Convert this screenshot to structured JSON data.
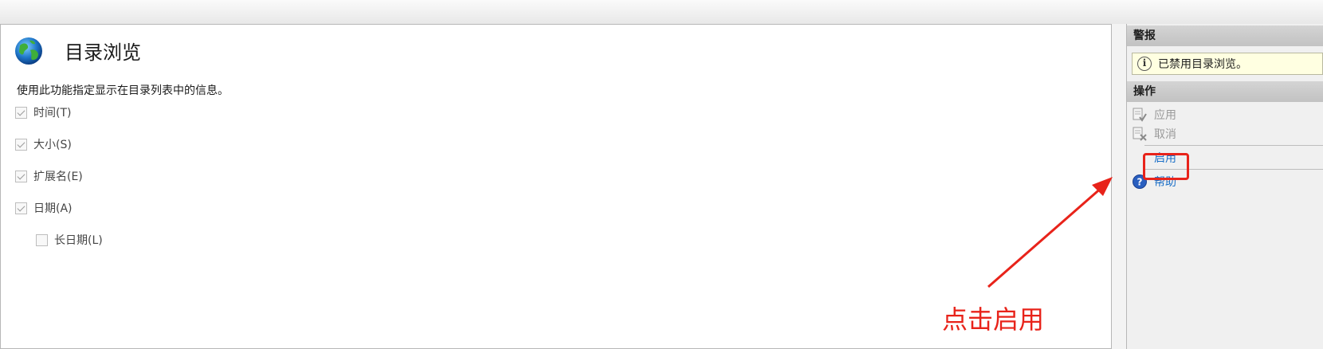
{
  "main": {
    "title": "目录浏览",
    "description": "使用此功能指定显示在目录列表中的信息。",
    "options": [
      {
        "label": "时间(T)",
        "checked": true
      },
      {
        "label": "大小(S)",
        "checked": true
      },
      {
        "label": "扩展名(E)",
        "checked": true
      },
      {
        "label": "日期(A)",
        "checked": true
      },
      {
        "label": "长日期(L)",
        "checked": false
      }
    ]
  },
  "sidebar": {
    "alerts_header": "警报",
    "alert_text": "已禁用目录浏览。",
    "actions_header": "操作",
    "actions": {
      "apply": "应用",
      "cancel": "取消",
      "enable": "启用",
      "help": "帮助"
    }
  },
  "annotation": {
    "text": "点击启用",
    "color": "#e8231a"
  },
  "icons": {
    "globe": "globe-icon",
    "info": "info-icon",
    "apply": "apply-icon",
    "cancel": "cancel-icon",
    "help": "help-icon"
  }
}
